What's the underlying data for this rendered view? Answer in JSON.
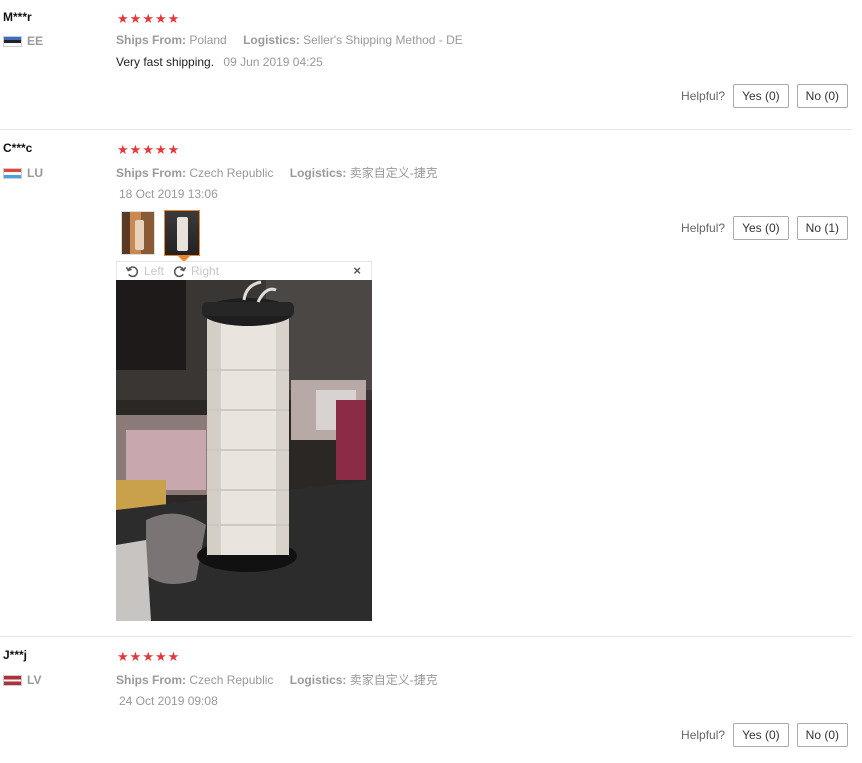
{
  "rating_star": "★",
  "reviews": [
    {
      "user": "M***r",
      "country": "EE",
      "ships_from_label": "Ships From:",
      "ships_from": "Poland",
      "logistics_label": "Logistics:",
      "logistics": "Seller's Shipping Method - DE",
      "text": "Very fast shipping.",
      "date": "09 Jun 2019 04:25",
      "helpful_label": "Helpful?",
      "yes": "Yes (0)",
      "no": "No (0)"
    },
    {
      "user": "C***c",
      "country": "LU",
      "ships_from_label": "Ships From:",
      "ships_from": "Czech Republic",
      "logistics_label": "Logistics:",
      "logistics": "卖家自定义-捷克",
      "date": "18 Oct 2019 13:06",
      "helpful_label": "Helpful?",
      "yes": "Yes (0)",
      "no": "No (1)",
      "viewer": {
        "left_label": "Left",
        "right_label": "Right",
        "close": "×"
      }
    },
    {
      "user": "J***j",
      "country": "LV",
      "ships_from_label": "Ships From:",
      "ships_from": "Czech Republic",
      "logistics_label": "Logistics:",
      "logistics": "卖家自定义-捷克",
      "date": "24 Oct 2019 09:08",
      "helpful_label": "Helpful?",
      "yes": "Yes (0)",
      "no": "No (0)"
    }
  ]
}
